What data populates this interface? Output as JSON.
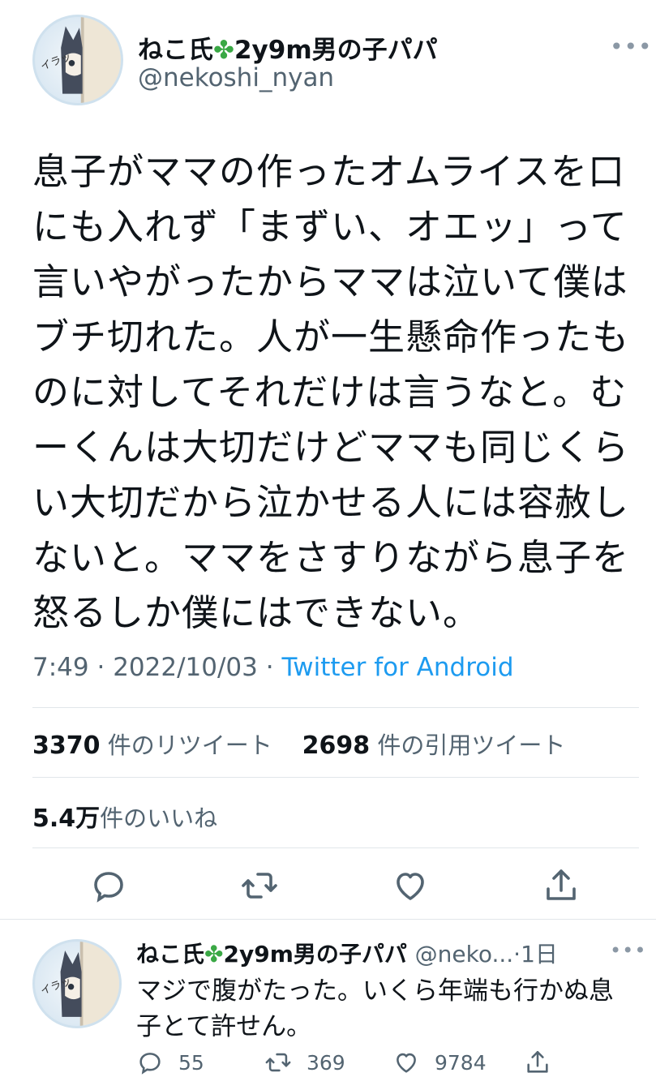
{
  "tweet": {
    "author_name": "ねこ氏",
    "author_name_suffix": "2y9m男の子パパ",
    "handle": "@nekoshi_nyan",
    "more_label": "•••",
    "text": "息子がママの作ったオムライスを口にも入れず「まずい、オエッ」って言いやがったからママは泣いて僕はブチ切れた。人が一生懸命作ったものに対してそれだけは言うなと。むーくんは大切だけどママも同じくらい大切だから泣かせる人には容赦しないと。ママをさすりながら息子を怒るしか僕にはできない。",
    "time": "7:49",
    "separator": " · ",
    "date": "2022/10/03",
    "source": "Twitter for Android",
    "stats": {
      "retweets": "3370",
      "retweets_label": "件のリツイート",
      "quotes": "2698",
      "quotes_label": "件の引用ツイート",
      "likes": "5.4万",
      "likes_label": "件のいいね"
    },
    "avatar_caption": "イラッ"
  },
  "reply": {
    "author_name": "ねこ氏",
    "author_name_suffix": "2y9m男の子パパ",
    "handle": "@neko...",
    "time": "·1日",
    "text": "マジで腹がたった。いくら年端も行かぬ息子とて許せん。",
    "reply_count": "55",
    "retweet_count": "369",
    "like_count": "9784"
  },
  "icons": {
    "reply": "reply-icon",
    "retweet": "retweet-icon",
    "like": "heart-icon",
    "share": "share-icon",
    "clover": "four-leaf-clover-icon"
  },
  "colors": {
    "text": "#0f1419",
    "secondary": "#536471",
    "link": "#1d9bf0",
    "divider": "#e1e6ea"
  }
}
